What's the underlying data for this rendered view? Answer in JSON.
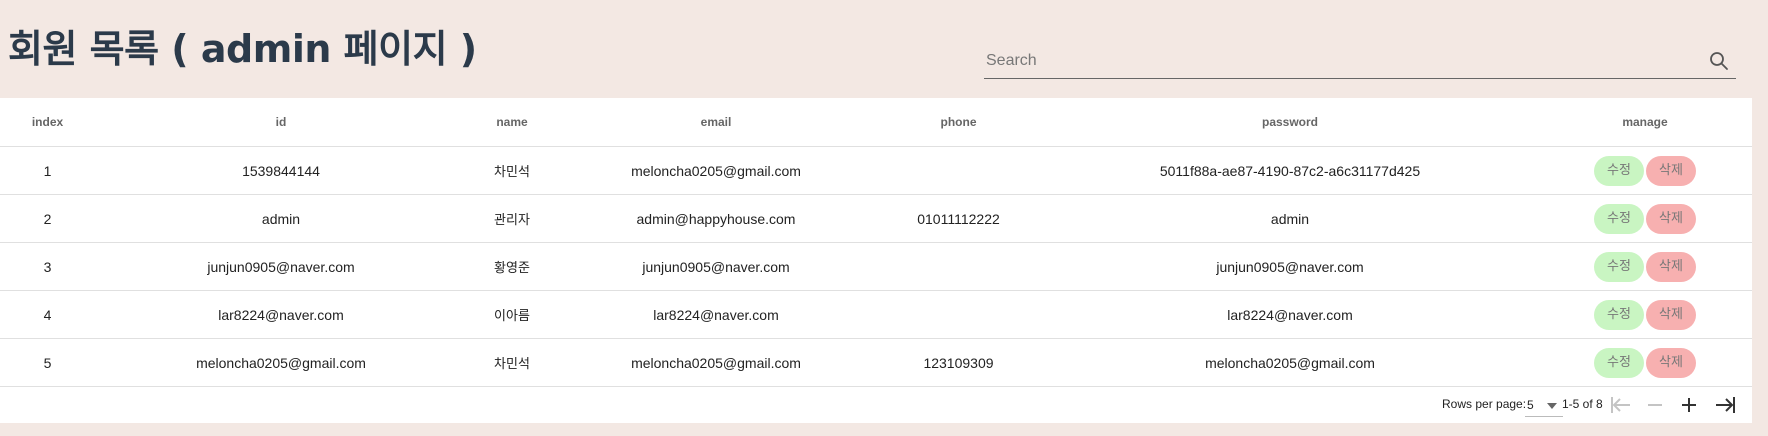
{
  "title": "회원 목록 ( admin 페이지 )",
  "search": {
    "placeholder": "Search",
    "value": ""
  },
  "table": {
    "columns": [
      "index",
      "id",
      "name",
      "email",
      "phone",
      "password",
      "manage"
    ],
    "rows": [
      {
        "index": "1",
        "id": "1539844144",
        "name": "차민석",
        "email": "meloncha0205@gmail.com",
        "phone": "",
        "password": "5011f88a-ae87-4190-87c2-a6c31177d425"
      },
      {
        "index": "2",
        "id": "admin",
        "name": "관리자",
        "email": "admin@happyhouse.com",
        "phone": "01011112222",
        "password": "admin"
      },
      {
        "index": "3",
        "id": "junjun0905@naver.com",
        "name": "황영준",
        "email": "junjun0905@naver.com",
        "phone": "",
        "password": "junjun0905@naver.com"
      },
      {
        "index": "4",
        "id": "lar8224@naver.com",
        "name": "이아름",
        "email": "lar8224@naver.com",
        "phone": "",
        "password": "lar8224@naver.com"
      },
      {
        "index": "5",
        "id": "meloncha0205@gmail.com",
        "name": "차민석",
        "email": "meloncha0205@gmail.com",
        "phone": "123109309",
        "password": "meloncha0205@gmail.com"
      }
    ],
    "edit_label": "수정",
    "delete_label": "삭제"
  },
  "pagination": {
    "rows_per_page_label": "Rows per page:",
    "rows_per_page_value": "5",
    "range_text": "1-5 of 8"
  },
  "colors": {
    "background": "#f3e8e3",
    "title": "#2b3a4a",
    "edit_button": "#c9f5c2",
    "delete_button": "#f7b0b0"
  },
  "icons": [
    "search-icon",
    "first-page-icon",
    "previous-page-icon",
    "next-page-icon",
    "last-page-icon"
  ]
}
